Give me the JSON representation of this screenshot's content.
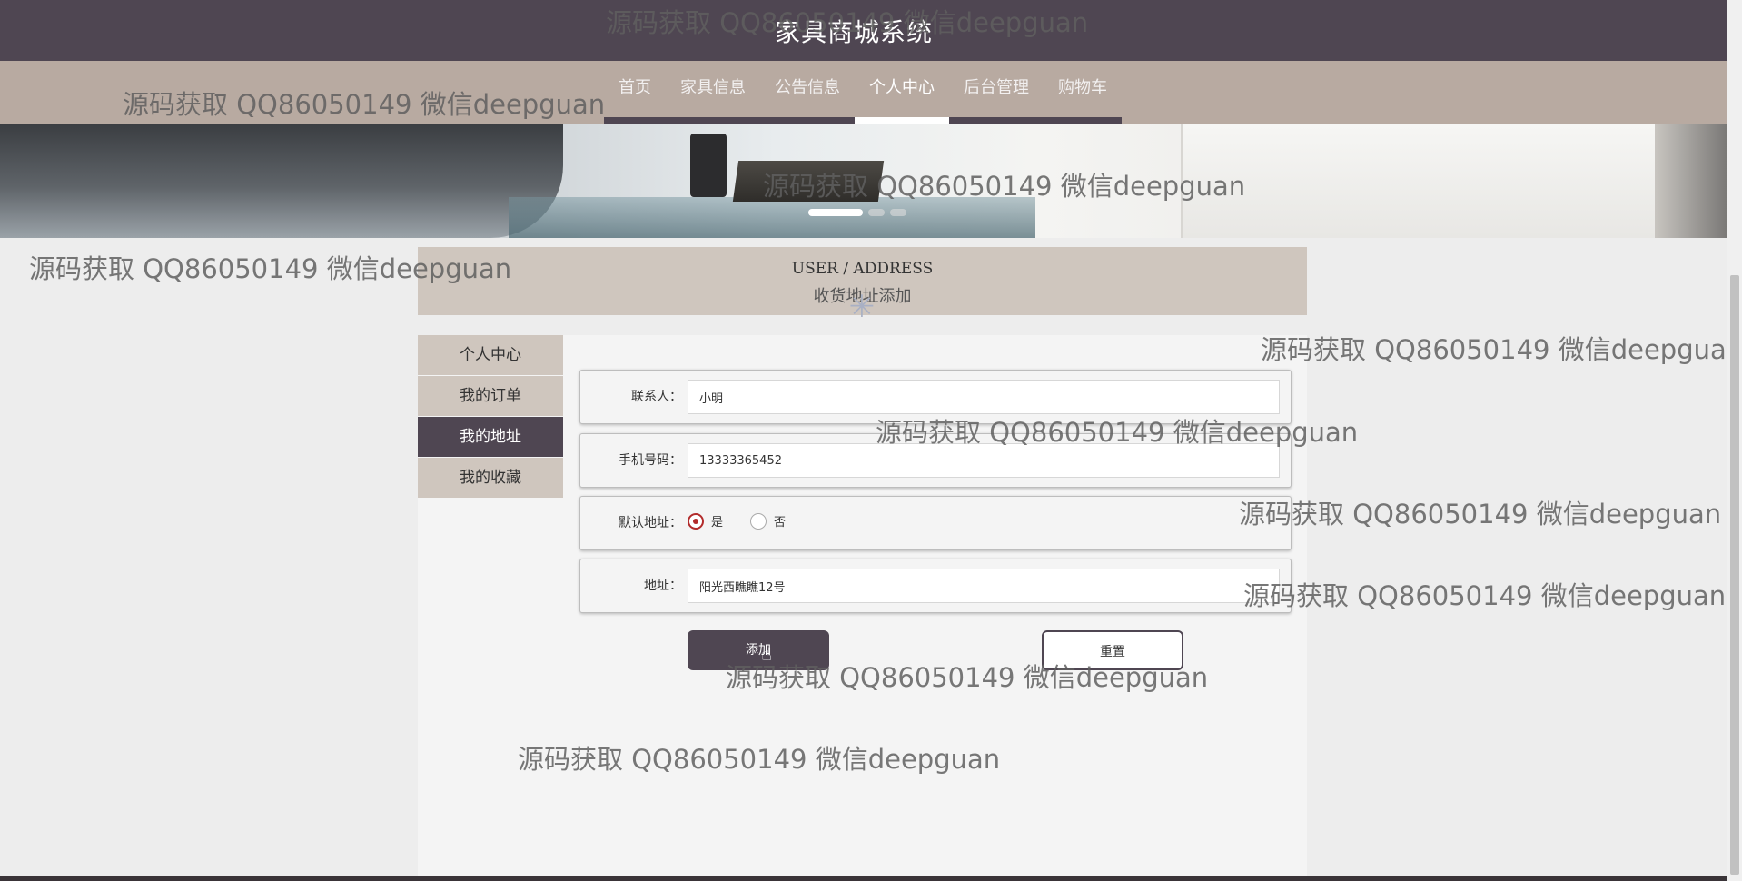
{
  "header": {
    "site_title": "家具商城系统"
  },
  "nav": {
    "items": [
      {
        "label": "首页"
      },
      {
        "label": "家具信息"
      },
      {
        "label": "公告信息"
      },
      {
        "label": "个人中心"
      },
      {
        "label": "后台管理"
      },
      {
        "label": "购物车"
      }
    ],
    "active_index": 3
  },
  "banner": {
    "slides_count": 3,
    "active_slide": 1
  },
  "page_title": {
    "en": "USER / ADDRESS",
    "cn": "收货地址添加"
  },
  "sidebar": {
    "items": [
      {
        "label": "个人中心"
      },
      {
        "label": "我的订单"
      },
      {
        "label": "我的地址"
      },
      {
        "label": "我的收藏"
      }
    ],
    "active_index": 2
  },
  "form": {
    "contact": {
      "label": "联系人：",
      "value": "小明"
    },
    "phone": {
      "label": "手机号码：",
      "value": "13333365452"
    },
    "default": {
      "label": "默认地址：",
      "options": [
        "是",
        "否"
      ],
      "selected": "是"
    },
    "address": {
      "label": "地址：",
      "value": "阳光西瞧瞧12号"
    },
    "add_button": "添加",
    "reset_button": "重置"
  },
  "watermark": "源码获取 QQ86050149 微信deepguan",
  "colors": {
    "header_bg": "#4f4652",
    "nav_bg": "#b8aaa1",
    "title_bg": "#cfc6be",
    "radio_accent": "#b22b2b"
  }
}
